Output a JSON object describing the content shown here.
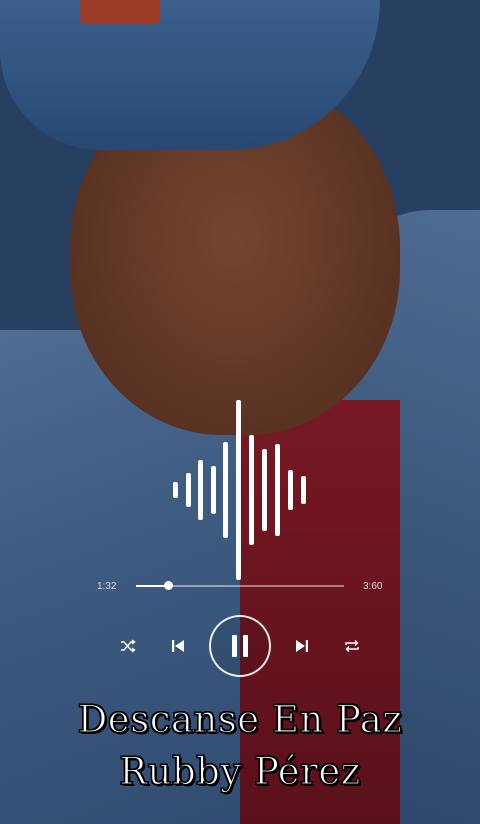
{
  "player": {
    "elapsed": "1:32",
    "duration": "3:60",
    "progress_fraction": 0.155
  },
  "controls": {
    "shuffle_icon": "shuffle-icon",
    "previous_icon": "skip-previous-icon",
    "pause_icon": "pause-icon",
    "next_icon": "skip-next-icon",
    "repeat_icon": "repeat-icon"
  },
  "caption": {
    "line1": "Descanse En Paz",
    "line2": "Rubby Pérez"
  },
  "colors": {
    "accent": "#ffffff",
    "text_stroke": "#000000"
  }
}
